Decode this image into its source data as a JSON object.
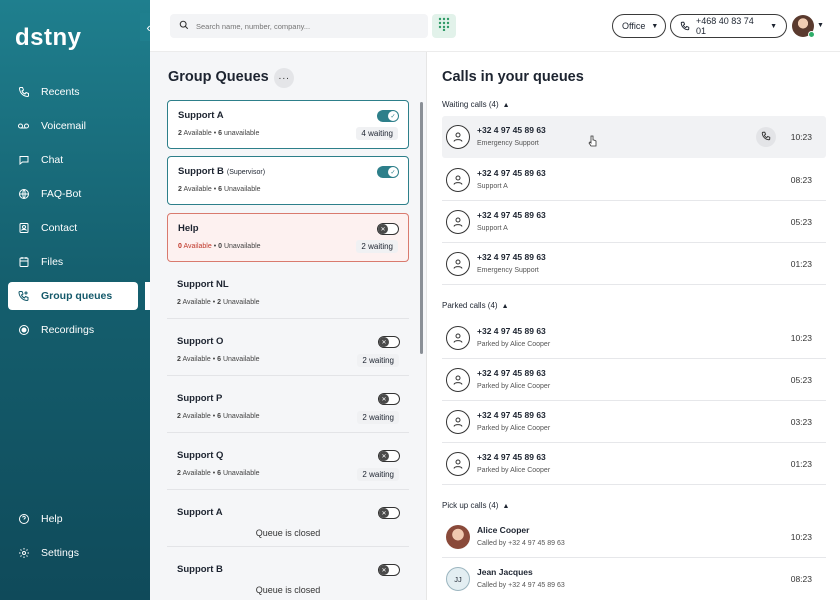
{
  "app": {
    "logo": "dstny"
  },
  "nav": {
    "items": [
      {
        "label": "Recents",
        "icon": "phone-icon"
      },
      {
        "label": "Voicemail",
        "icon": "voicemail-icon"
      },
      {
        "label": "Chat",
        "icon": "chat-icon"
      },
      {
        "label": "FAQ-Bot",
        "icon": "globe-icon"
      },
      {
        "label": "Contact",
        "icon": "contact-card-icon"
      },
      {
        "label": "Files",
        "icon": "file-icon"
      },
      {
        "label": "Group queues",
        "icon": "group-queue-icon",
        "active": true
      },
      {
        "label": "Recordings",
        "icon": "record-icon"
      }
    ],
    "bottom": [
      {
        "label": "Help",
        "icon": "help-icon"
      },
      {
        "label": "Settings",
        "icon": "gear-icon"
      }
    ]
  },
  "topbar": {
    "search_placeholder": "Search name, number, company...",
    "status": "Office",
    "phone_number": "+468 40 83 74 01"
  },
  "group_queues": {
    "title": "Group Queues",
    "more": "···",
    "queues": [
      {
        "name": "Support A",
        "sub": "",
        "available": "2",
        "available_label": "Available",
        "unavailable": "6",
        "unavailable_label": "unavailable",
        "waiting": "4 waiting",
        "enabled": true,
        "closed": ""
      },
      {
        "name": "Support B",
        "sub": "(Supervisor)",
        "available": "2",
        "available_label": "Available",
        "unavailable": "6",
        "unavailable_label": "Unavailable",
        "waiting": "",
        "enabled": true,
        "closed": ""
      },
      {
        "name": "Help",
        "sub": "",
        "available": "0",
        "available_label": "Available",
        "unavailable": "0",
        "unavailable_label": "Unavailable",
        "waiting": "2 waiting",
        "enabled": false,
        "closed": ""
      },
      {
        "name": "Support NL",
        "sub": "",
        "available": "2",
        "available_label": "Available",
        "unavailable": "2",
        "unavailable_label": "Unavailable",
        "waiting": "",
        "enabled": null,
        "closed": ""
      },
      {
        "name": "Support O",
        "sub": "",
        "available": "2",
        "available_label": "Available",
        "unavailable": "6",
        "unavailable_label": "Unavailable",
        "waiting": "2 waiting",
        "enabled": false,
        "closed": ""
      },
      {
        "name": "Support P",
        "sub": "",
        "available": "2",
        "available_label": "Available",
        "unavailable": "6",
        "unavailable_label": "Unavailable",
        "waiting": "2 waiting",
        "enabled": false,
        "closed": ""
      },
      {
        "name": "Support Q",
        "sub": "",
        "available": "2",
        "available_label": "Available",
        "unavailable": "6",
        "unavailable_label": "Unavailable",
        "waiting": "2 waiting",
        "enabled": false,
        "closed": ""
      },
      {
        "name": "Support A",
        "sub": "",
        "available": "",
        "available_label": "",
        "unavailable": "",
        "unavailable_label": "",
        "waiting": "",
        "enabled": false,
        "closed": "Queue is closed"
      },
      {
        "name": "Support B",
        "sub": "",
        "available": "",
        "available_label": "",
        "unavailable": "",
        "unavailable_label": "",
        "waiting": "",
        "enabled": false,
        "closed": "Queue is closed"
      }
    ]
  },
  "calls": {
    "title": "Calls in your queues",
    "waiting_label": "Waiting calls (4)",
    "parked_label": "Parked calls (4)",
    "pickup_label": "Pick up calls (4)",
    "waiting": [
      {
        "number": "+32 4 97 45 89 63",
        "sub": "Emergency Support",
        "time": "10:23"
      },
      {
        "number": "+32 4 97 45 89 63",
        "sub": "Support A",
        "time": "08:23"
      },
      {
        "number": "+32 4 97 45 89 63",
        "sub": "Support A",
        "time": "05:23"
      },
      {
        "number": "+32 4 97 45 89 63",
        "sub": "Emergency Support",
        "time": "01:23"
      }
    ],
    "parked": [
      {
        "number": "+32 4 97 45 89 63",
        "sub": "Parked by Alice Cooper",
        "time": "10:23"
      },
      {
        "number": "+32 4 97 45 89 63",
        "sub": "Parked by Alice Cooper",
        "time": "05:23"
      },
      {
        "number": "+32 4 97 45 89 63",
        "sub": "Parked by Alice Cooper",
        "time": "03:23"
      },
      {
        "number": "+32 4 97 45 89 63",
        "sub": "Parked by Alice Cooper",
        "time": "01:23"
      }
    ],
    "pickup": [
      {
        "name": "Alice Cooper",
        "sub": "Called by +32 4 97 45 89 63",
        "time": "10:23",
        "initials": ""
      },
      {
        "name": "Jean Jacques",
        "sub": "Called by +32 4 97 45 89 63",
        "time": "08:23",
        "initials": "JJ"
      }
    ]
  },
  "colors": {
    "sidebar": "#1f7f8e",
    "accent": "#2d7f8a",
    "help_border": "#d97a6e",
    "help_bg": "#fdf1f0"
  }
}
